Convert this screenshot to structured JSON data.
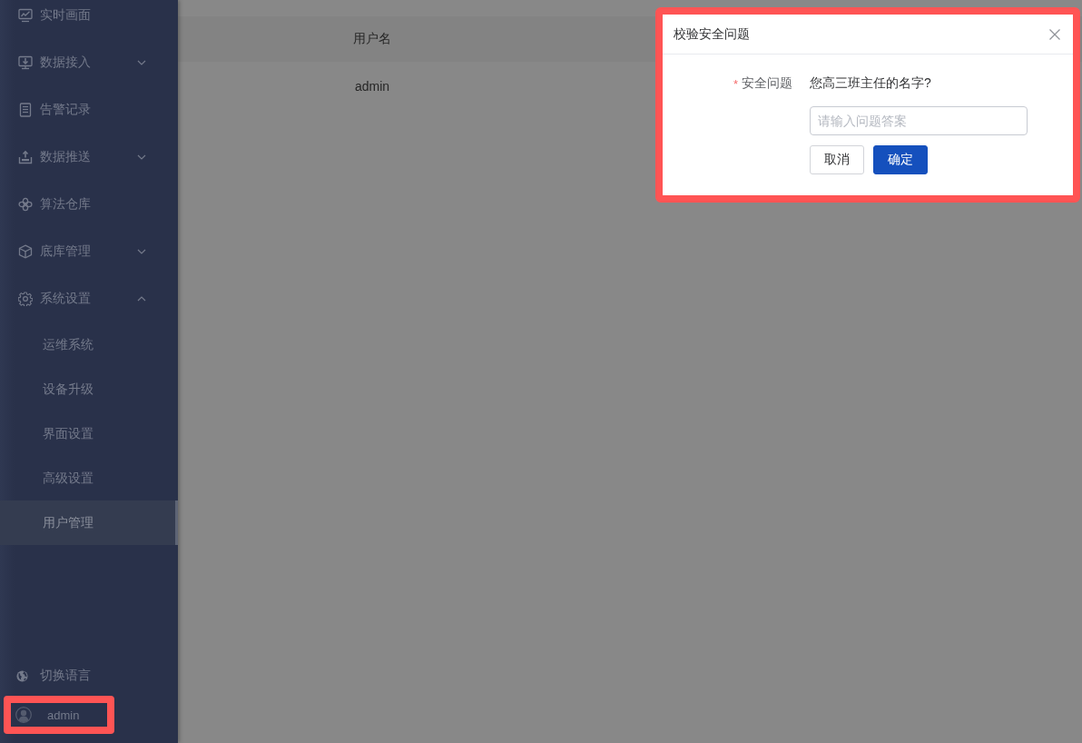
{
  "sidebar": {
    "menu": [
      {
        "kind": "link",
        "label": "实时画面"
      },
      {
        "kind": "group",
        "label": "数据接入",
        "expanded": false
      },
      {
        "kind": "link",
        "label": "告警记录"
      },
      {
        "kind": "group",
        "label": "数据推送",
        "expanded": false
      },
      {
        "kind": "link",
        "label": "算法仓库"
      },
      {
        "kind": "group",
        "label": "底库管理",
        "expanded": false
      },
      {
        "kind": "group",
        "label": "系统设置",
        "expanded": true,
        "children": [
          {
            "label": "运维系统",
            "selected": false
          },
          {
            "label": "设备升级",
            "selected": false
          },
          {
            "label": "界面设置",
            "selected": false
          },
          {
            "label": "高级设置",
            "selected": false
          },
          {
            "label": "用户管理",
            "selected": true
          }
        ]
      }
    ],
    "language_item": {
      "label": "切换语言",
      "highlighted": false
    },
    "user": {
      "name": "admin",
      "highlighted": true
    }
  },
  "table": {
    "columns": [
      "用户名"
    ],
    "rows": [
      [
        "admin"
      ]
    ]
  },
  "dialog": {
    "title": "校验安全问题",
    "highlighted": true,
    "required_mark": "*",
    "field_label": "安全问题",
    "question": "您高三班主任的名字?",
    "answer": {
      "placeholder": "请输入问题答案"
    },
    "buttons": [
      {
        "kind": "default",
        "label": "取消"
      },
      {
        "kind": "primary",
        "label": "确定"
      }
    ]
  }
}
